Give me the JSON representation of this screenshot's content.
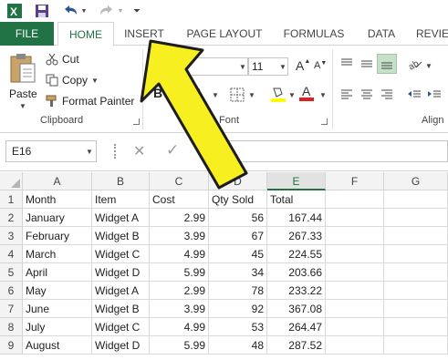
{
  "qat": {
    "save_icon": "save-icon",
    "undo_icon": "undo-icon",
    "redo_icon": "redo-icon"
  },
  "tabs": [
    {
      "label": "FILE"
    },
    {
      "label": "HOME"
    },
    {
      "label": "INSERT"
    },
    {
      "label": "PAGE LAYOUT"
    },
    {
      "label": "FORMULAS"
    },
    {
      "label": "DATA"
    },
    {
      "label": "REVIE"
    }
  ],
  "ribbon": {
    "clipboard": {
      "paste": "Paste",
      "cut": "Cut",
      "copy": "Copy",
      "format_painter": "Format Painter",
      "label": "Clipboard"
    },
    "font": {
      "size": "11",
      "bold": "B",
      "italic": "I",
      "underline": "U",
      "font_color_letter": "A",
      "label": "Font"
    },
    "alignment": {
      "label": "Align"
    },
    "colors": {
      "accent": "#217346",
      "highlight": "#ffff00",
      "font_red": "#e02020",
      "arrow_fill": "#f8ef20"
    }
  },
  "formula_bar": {
    "name_box": "E16",
    "cancel": "✕",
    "enter": "✓",
    "value": ""
  },
  "grid": {
    "columns": [
      "A",
      "B",
      "C",
      "D",
      "E",
      "F",
      "G"
    ],
    "rows": [
      {
        "n": "1",
        "cells": [
          "Month",
          "Item",
          "Cost",
          "Qty Sold",
          "Total"
        ]
      },
      {
        "n": "2",
        "cells": [
          "January",
          "Widget A",
          "2.99",
          "56",
          "167.44"
        ]
      },
      {
        "n": "3",
        "cells": [
          "February",
          "Widget B",
          "3.99",
          "67",
          "267.33"
        ]
      },
      {
        "n": "4",
        "cells": [
          "March",
          "Widget C",
          "4.99",
          "45",
          "224.55"
        ]
      },
      {
        "n": "5",
        "cells": [
          "April",
          "Widget D",
          "5.99",
          "34",
          "203.66"
        ]
      },
      {
        "n": "6",
        "cells": [
          "May",
          "Widget A",
          "2.99",
          "78",
          "233.22"
        ]
      },
      {
        "n": "7",
        "cells": [
          "June",
          "Widget B",
          "3.99",
          "92",
          "367.08"
        ]
      },
      {
        "n": "8",
        "cells": [
          "July",
          "Widget C",
          "4.99",
          "53",
          "264.47"
        ]
      },
      {
        "n": "9",
        "cells": [
          "August",
          "Widget D",
          "5.99",
          "48",
          "287.52"
        ]
      }
    ]
  }
}
